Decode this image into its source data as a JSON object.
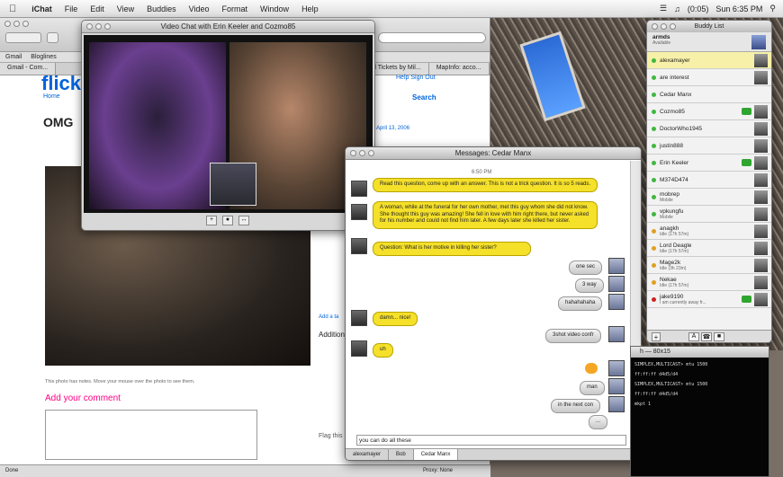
{
  "menubar": {
    "app": "iChat",
    "items": [
      "File",
      "Edit",
      "View",
      "Buddies",
      "Video",
      "Format",
      "Window",
      "Help"
    ],
    "clock": "Sun 6:35 PM",
    "battery": "(0:05)"
  },
  "browser": {
    "bookmarks": [
      "Gmail",
      "Bloglines"
    ],
    "tabs": [
      "Gmail - Com...",
      "All Tickets by Mil...",
      "MapInfo: acco..."
    ],
    "logo": "flick",
    "nav": "Home",
    "title": "OMG",
    "header_links": "Help  Sign Out",
    "search": "Search",
    "date": "April 13, 2006",
    "caption": "This photo has notes. Move your mouse over the photo to see them.",
    "add_comment": "Add your comment",
    "sidebar_heading": "Addition",
    "add_tag": "Add a ta",
    "flag": "Flag this",
    "status_left": "Done",
    "status_right": "Proxy: None"
  },
  "video": {
    "title": "Video Chat with Erin Keeler and Cozmo85"
  },
  "messages": {
    "title": "Messages: Cedar Manx",
    "time": "6:50 PM",
    "input": "you can do all these",
    "bubbles": [
      {
        "text": "Read this question, come up with an answer. This is not a trick question. It is so 5 reads."
      },
      {
        "text": "A woman, while at the funeral for her own mother, met this guy whom she did not know. She thought this guy was amazing! She fell in love with him right there, but never asked for his number and could not find him later. A few days later she killed her sister."
      },
      {
        "text": "Question: What is her motive in killing her sister?"
      },
      {
        "text": "one sec"
      },
      {
        "text": "3 way"
      },
      {
        "text": "hahahahaha"
      },
      {
        "text": "damn... nice!"
      },
      {
        "text": "3shot video confr"
      },
      {
        "text": "uh"
      },
      {
        "text": "man"
      },
      {
        "text": "in the next con"
      },
      {
        "text": "..."
      }
    ],
    "tabs": [
      "alexamayer",
      "Bob",
      "Cedar Manx"
    ]
  },
  "buddy": {
    "title": "Buddy List",
    "me": "armds",
    "status": "Available",
    "items": [
      {
        "name": "alexamayer",
        "sub": ""
      },
      {
        "name": "are interest",
        "sub": ""
      },
      {
        "name": "Cedar Manx",
        "sub": ""
      },
      {
        "name": "Cozmo85",
        "sub": ""
      },
      {
        "name": "DoctorWho1945",
        "sub": ""
      },
      {
        "name": "justin888",
        "sub": ""
      },
      {
        "name": "Erin Keeler",
        "sub": ""
      },
      {
        "name": "M374D474",
        "sub": ""
      },
      {
        "name": "mobrep",
        "sub": "Mobile"
      },
      {
        "name": "vpkungfu",
        "sub": "Mobile"
      },
      {
        "name": "anagkh",
        "sub": "Idle (17h 57m)"
      },
      {
        "name": "Lord Deagle",
        "sub": "Idle (17h 57m)"
      },
      {
        "name": "Mage2k",
        "sub": "Idle (3h 23m)"
      },
      {
        "name": "Nekae",
        "sub": "Idle (17h 57m)"
      },
      {
        "name": "jake9190",
        "sub": "I am currently away fr..."
      }
    ]
  },
  "terminal": {
    "title": "h — 80x15",
    "lines": [
      "SIMPLEX,MULTICAST> mtu 1500",
      "ff:ff:ff d4d5/d4",
      "",
      "SIMPLEX,MULTICAST> mtu 1500",
      "ff:ff:ff d4d5/d4",
      "",
      "",
      "mkpt 1"
    ]
  }
}
